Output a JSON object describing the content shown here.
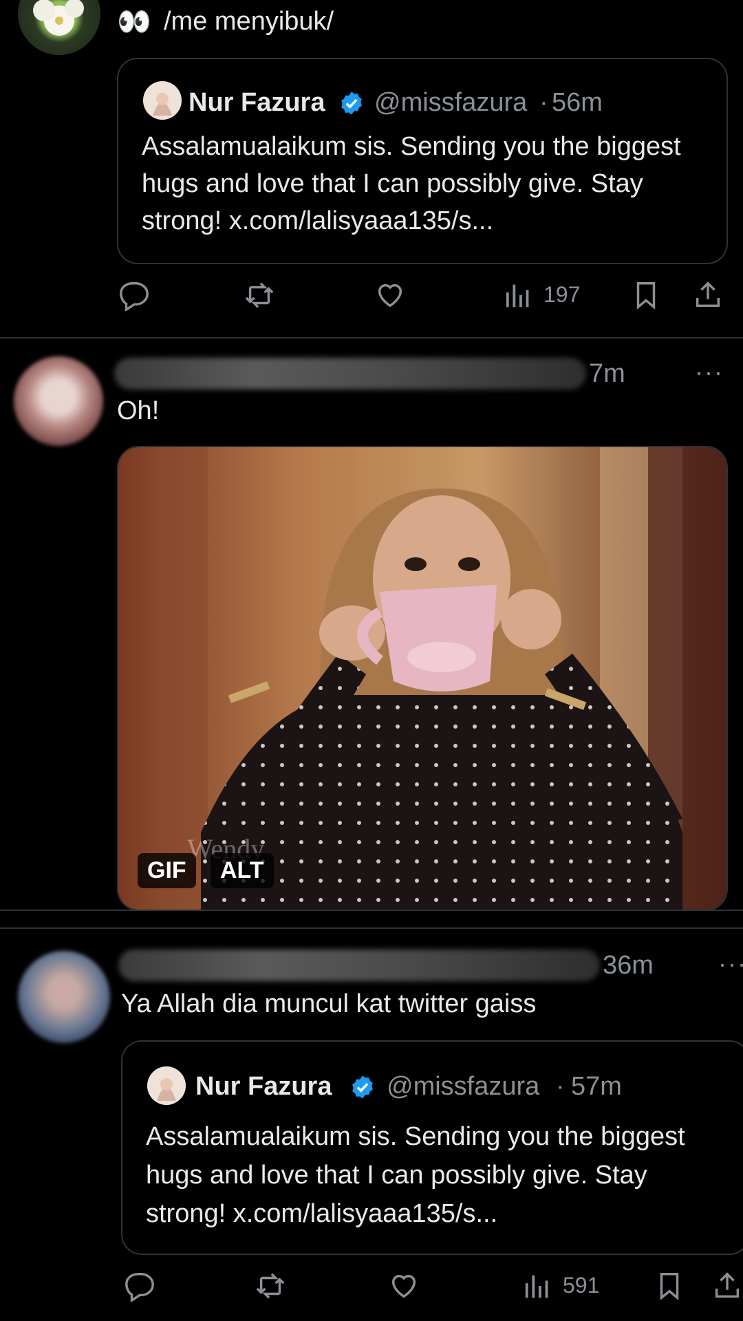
{
  "tweet1": {
    "emoji": "👀",
    "text": "/me menyibuk/",
    "quote": {
      "name": "Nur Fazura",
      "handle": "@missfazura",
      "time": "56m",
      "body": "Assalamualaikum sis. Sending you the biggest hugs and love that I can possibly give. Stay strong! x.com/lalisyaaa135/s..."
    },
    "views": "197"
  },
  "tweet2": {
    "time": "7m",
    "more": "···",
    "text": "Oh!",
    "gif_badge": "GIF",
    "alt_badge": "ALT",
    "watermark": "Wendy"
  },
  "tweet3": {
    "time": "36m",
    "more": "···",
    "text": "Ya Allah dia muncul kat twitter gaiss",
    "quote": {
      "name": "Nur Fazura",
      "handle": "@missfazura",
      "time": "57m",
      "body": "Assalamualaikum sis. Sending you the biggest hugs and love that I can possibly give. Stay strong! x.com/lalisyaaa135/s..."
    },
    "views": "591"
  },
  "icons": {
    "reply": "reply-icon",
    "retweet": "retweet-icon",
    "like": "heart-icon",
    "views": "views-icon",
    "bookmark": "bookmark-icon",
    "share": "share-icon",
    "verified": "verified-badge-icon"
  },
  "colors": {
    "background": "#000000",
    "text": "#e7e9ea",
    "secondary": "#8b9096",
    "verified": "#1d9bf0",
    "border": "#2f3336"
  }
}
